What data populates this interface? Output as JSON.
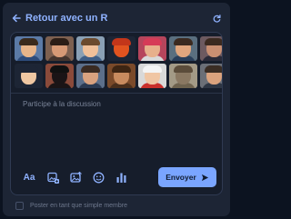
{
  "header": {
    "title": "Retour avec un R",
    "back_icon": "arrow-left-icon",
    "refresh_icon": "refresh-icon"
  },
  "stickers": {
    "row1": [
      {
        "name": "sticker-sunglasses-man",
        "bg": "#5b7aa6",
        "skin": "#e8b58a",
        "hair": "#3a2a1c",
        "body": "#2d4b7a"
      },
      {
        "name": "sticker-laughing-man",
        "bg": "#7d6050",
        "skin": "#d79a76",
        "hair": "#2b1d16",
        "body": "#45352e"
      },
      {
        "name": "sticker-shocked-man",
        "bg": "#8aa0b5",
        "skin": "#f0c09a",
        "hair": "#6b4a2e",
        "body": "#3f5e86"
      },
      {
        "name": "sticker-devil-emoji",
        "bg": "#1d2535",
        "skin": "#e2531f",
        "hair": "#c3361a",
        "body": "#1d2535"
      },
      {
        "name": "sticker-cap-man",
        "bg": "#b5455c",
        "skin": "#e7b08c",
        "hair": "#d63b57",
        "body": "#d9d9d9"
      },
      {
        "name": "sticker-smiling-man",
        "bg": "#5a6f7f",
        "skin": "#e1a67e",
        "hair": "#3b2a20",
        "body": "#2a3f5a"
      },
      {
        "name": "sticker-partial",
        "bg": "#6d5a60",
        "skin": "#c98f72",
        "hair": "#3b2a20",
        "body": "#2a2a38"
      }
    ],
    "row2": [
      {
        "name": "sticker-peace-hand",
        "bg": "#1d2535",
        "skin": "#efc7a2",
        "hair": "#1d2535",
        "body": "#1d2535"
      },
      {
        "name": "sticker-black-cat",
        "bg": "#8a4a3a",
        "skin": "#1a1416",
        "hair": "#111",
        "body": "#1a1416"
      },
      {
        "name": "sticker-serious-man",
        "bg": "#5c6f8a",
        "skin": "#d9a27f",
        "hair": "#3a2b22",
        "body": "#2b3a52"
      },
      {
        "name": "sticker-bearded-man",
        "bg": "#7a4a2a",
        "skin": "#c88b5f",
        "hair": "#3d2513",
        "body": "#4a2f1c"
      },
      {
        "name": "sticker-santa",
        "bg": "#d9d9d9",
        "skin": "#f0c6a4",
        "hair": "#f4f4f4",
        "body": "#c9302c"
      },
      {
        "name": "sticker-binoculars-man",
        "bg": "#a39a86",
        "skin": "#8a7862",
        "hair": "#5b4c3a",
        "body": "#6e624e"
      },
      {
        "name": "sticker-glasses-man",
        "bg": "#6b6f77",
        "skin": "#dba37e",
        "hair": "#3a2d24",
        "body": "#2e3644"
      },
      {
        "name": "sticker-partial-2",
        "bg": "#45506a",
        "skin": "#cf9a7a",
        "hair": "#2b2430",
        "body": "#2b3040"
      }
    ]
  },
  "input": {
    "placeholder": "Participe à la discussion"
  },
  "toolbar": {
    "format_label": "Aa",
    "tools": [
      "format-text-icon",
      "gif-image-icon",
      "image-upload-icon",
      "emoji-icon",
      "poll-chart-icon"
    ],
    "send_label": "Envoyer",
    "send_icon": "send-arrow-icon"
  },
  "footer": {
    "checkbox_label": "Poster en tant que simple membre",
    "checked": false
  },
  "colors": {
    "accent": "#7aa5ff",
    "card": "#1d2535",
    "background": "#0c1320"
  }
}
